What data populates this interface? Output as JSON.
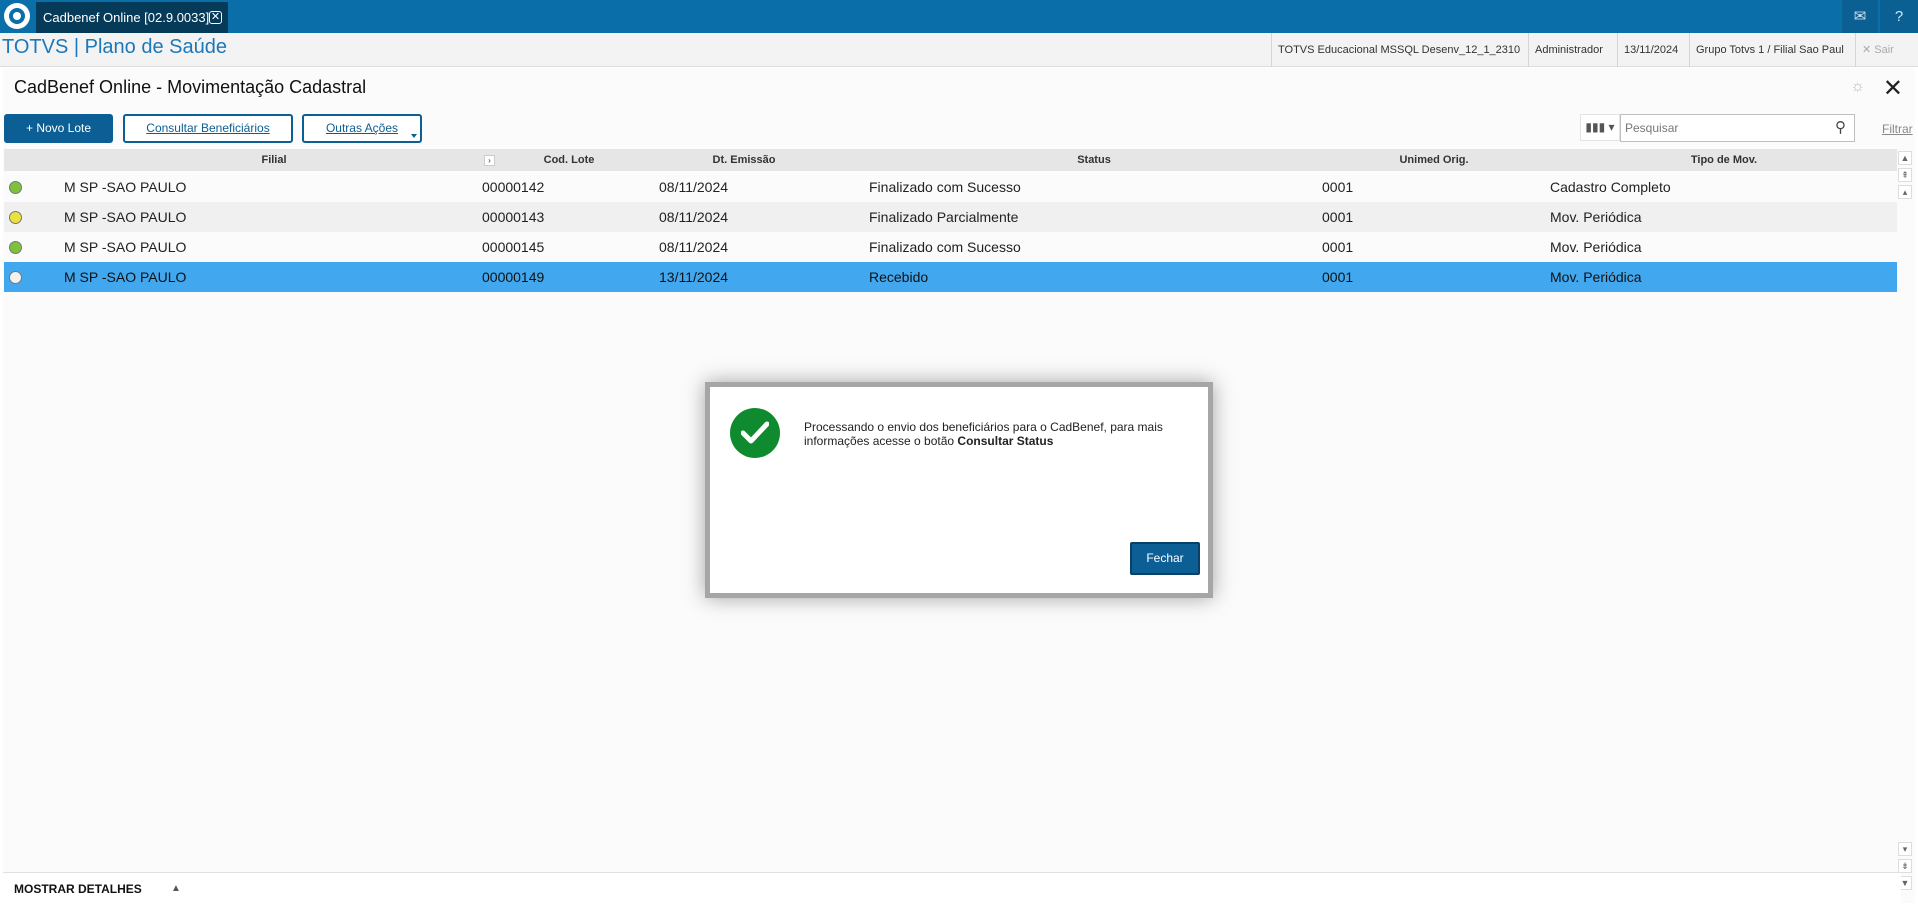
{
  "topbar": {
    "tab_label": "Cadbenef Online [02.9.0033]",
    "tab_close_glyph": "✕",
    "mail_glyph": "✉",
    "help_glyph": "?"
  },
  "header": {
    "brand": "TOTVS | Plano de Saúde",
    "environment": "TOTVS Educacional MSSQL Desenv_12_1_2310",
    "user": "Administrador",
    "date": "13/11/2024",
    "company": "Grupo Totvs 1 / Filial Sao Paul",
    "logout": "Sair"
  },
  "page": {
    "title": "CadBenef Online - Movimentação Cadastral"
  },
  "toolbar": {
    "new_batch": "Novo Lote",
    "consult_beneficiaries": "Consultar Beneficiários",
    "other_actions": "Outras Ações",
    "search_placeholder": "Pesquisar",
    "filter": "Filtrar"
  },
  "table": {
    "columns": [
      "Filial",
      "Cod. Lote",
      "Dt. Emissão",
      "Status",
      "Unimed Orig.",
      "Tipo de Mov."
    ],
    "rows": [
      {
        "status_color": "#7cc33a",
        "filial": "M SP -SAO PAULO",
        "lote": "00000142",
        "emissao": "08/11/2024",
        "status": "Finalizado com Sucesso",
        "unimed": "0001",
        "tipo": "Cadastro Completo"
      },
      {
        "status_color": "#e9e23a",
        "filial": "M SP -SAO PAULO",
        "lote": "00000143",
        "emissao": "08/11/2024",
        "status": "Finalizado Parcialmente",
        "unimed": "0001",
        "tipo": "Mov. Periódica"
      },
      {
        "status_color": "#7cc33a",
        "filial": "M SP -SAO PAULO",
        "lote": "00000145",
        "emissao": "08/11/2024",
        "status": "Finalizado com Sucesso",
        "unimed": "0001",
        "tipo": "Mov. Periódica"
      },
      {
        "status_color": "#f2f2f2",
        "filial": "M SP -SAO PAULO",
        "lote": "00000149",
        "emissao": "13/11/2024",
        "status": "Recebido",
        "unimed": "0001",
        "tipo": "Mov. Periódica"
      }
    ],
    "selected_row": 3
  },
  "footer": {
    "label": "MOSTRAR DETALHES"
  },
  "modal": {
    "message_prefix": "Processando o envio dos beneficiários para o CadBenef, para mais informações acesse o botão ",
    "message_bold": "Consultar Status",
    "button": "Fechar"
  }
}
